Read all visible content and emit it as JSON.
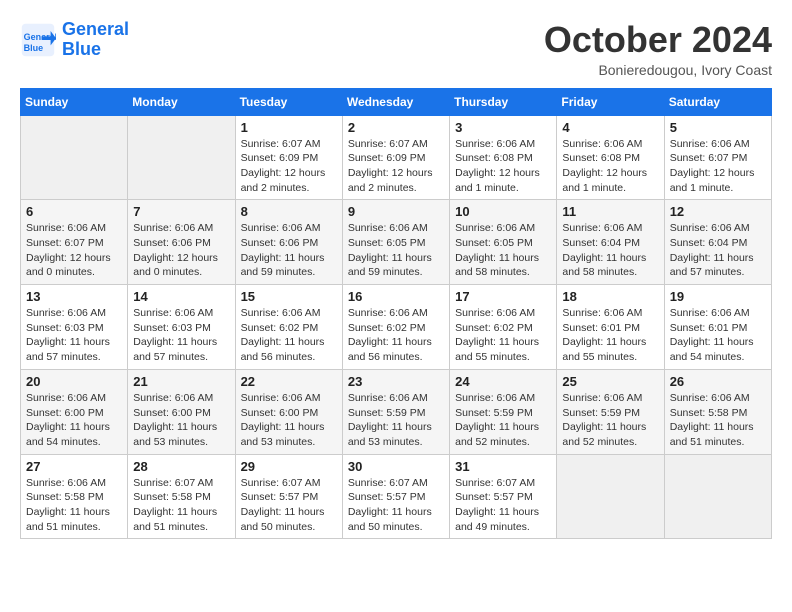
{
  "logo": {
    "line1": "General",
    "line2": "Blue"
  },
  "title": "October 2024",
  "subtitle": "Bonieredougou, Ivory Coast",
  "days_header": [
    "Sunday",
    "Monday",
    "Tuesday",
    "Wednesday",
    "Thursday",
    "Friday",
    "Saturday"
  ],
  "weeks": [
    [
      {
        "day": "",
        "detail": ""
      },
      {
        "day": "",
        "detail": ""
      },
      {
        "day": "1",
        "detail": "Sunrise: 6:07 AM\nSunset: 6:09 PM\nDaylight: 12 hours and 2 minutes."
      },
      {
        "day": "2",
        "detail": "Sunrise: 6:07 AM\nSunset: 6:09 PM\nDaylight: 12 hours and 2 minutes."
      },
      {
        "day": "3",
        "detail": "Sunrise: 6:06 AM\nSunset: 6:08 PM\nDaylight: 12 hours and 1 minute."
      },
      {
        "day": "4",
        "detail": "Sunrise: 6:06 AM\nSunset: 6:08 PM\nDaylight: 12 hours and 1 minute."
      },
      {
        "day": "5",
        "detail": "Sunrise: 6:06 AM\nSunset: 6:07 PM\nDaylight: 12 hours and 1 minute."
      }
    ],
    [
      {
        "day": "6",
        "detail": "Sunrise: 6:06 AM\nSunset: 6:07 PM\nDaylight: 12 hours and 0 minutes."
      },
      {
        "day": "7",
        "detail": "Sunrise: 6:06 AM\nSunset: 6:06 PM\nDaylight: 12 hours and 0 minutes."
      },
      {
        "day": "8",
        "detail": "Sunrise: 6:06 AM\nSunset: 6:06 PM\nDaylight: 11 hours and 59 minutes."
      },
      {
        "day": "9",
        "detail": "Sunrise: 6:06 AM\nSunset: 6:05 PM\nDaylight: 11 hours and 59 minutes."
      },
      {
        "day": "10",
        "detail": "Sunrise: 6:06 AM\nSunset: 6:05 PM\nDaylight: 11 hours and 58 minutes."
      },
      {
        "day": "11",
        "detail": "Sunrise: 6:06 AM\nSunset: 6:04 PM\nDaylight: 11 hours and 58 minutes."
      },
      {
        "day": "12",
        "detail": "Sunrise: 6:06 AM\nSunset: 6:04 PM\nDaylight: 11 hours and 57 minutes."
      }
    ],
    [
      {
        "day": "13",
        "detail": "Sunrise: 6:06 AM\nSunset: 6:03 PM\nDaylight: 11 hours and 57 minutes."
      },
      {
        "day": "14",
        "detail": "Sunrise: 6:06 AM\nSunset: 6:03 PM\nDaylight: 11 hours and 57 minutes."
      },
      {
        "day": "15",
        "detail": "Sunrise: 6:06 AM\nSunset: 6:02 PM\nDaylight: 11 hours and 56 minutes."
      },
      {
        "day": "16",
        "detail": "Sunrise: 6:06 AM\nSunset: 6:02 PM\nDaylight: 11 hours and 56 minutes."
      },
      {
        "day": "17",
        "detail": "Sunrise: 6:06 AM\nSunset: 6:02 PM\nDaylight: 11 hours and 55 minutes."
      },
      {
        "day": "18",
        "detail": "Sunrise: 6:06 AM\nSunset: 6:01 PM\nDaylight: 11 hours and 55 minutes."
      },
      {
        "day": "19",
        "detail": "Sunrise: 6:06 AM\nSunset: 6:01 PM\nDaylight: 11 hours and 54 minutes."
      }
    ],
    [
      {
        "day": "20",
        "detail": "Sunrise: 6:06 AM\nSunset: 6:00 PM\nDaylight: 11 hours and 54 minutes."
      },
      {
        "day": "21",
        "detail": "Sunrise: 6:06 AM\nSunset: 6:00 PM\nDaylight: 11 hours and 53 minutes."
      },
      {
        "day": "22",
        "detail": "Sunrise: 6:06 AM\nSunset: 6:00 PM\nDaylight: 11 hours and 53 minutes."
      },
      {
        "day": "23",
        "detail": "Sunrise: 6:06 AM\nSunset: 5:59 PM\nDaylight: 11 hours and 53 minutes."
      },
      {
        "day": "24",
        "detail": "Sunrise: 6:06 AM\nSunset: 5:59 PM\nDaylight: 11 hours and 52 minutes."
      },
      {
        "day": "25",
        "detail": "Sunrise: 6:06 AM\nSunset: 5:59 PM\nDaylight: 11 hours and 52 minutes."
      },
      {
        "day": "26",
        "detail": "Sunrise: 6:06 AM\nSunset: 5:58 PM\nDaylight: 11 hours and 51 minutes."
      }
    ],
    [
      {
        "day": "27",
        "detail": "Sunrise: 6:06 AM\nSunset: 5:58 PM\nDaylight: 11 hours and 51 minutes."
      },
      {
        "day": "28",
        "detail": "Sunrise: 6:07 AM\nSunset: 5:58 PM\nDaylight: 11 hours and 51 minutes."
      },
      {
        "day": "29",
        "detail": "Sunrise: 6:07 AM\nSunset: 5:57 PM\nDaylight: 11 hours and 50 minutes."
      },
      {
        "day": "30",
        "detail": "Sunrise: 6:07 AM\nSunset: 5:57 PM\nDaylight: 11 hours and 50 minutes."
      },
      {
        "day": "31",
        "detail": "Sunrise: 6:07 AM\nSunset: 5:57 PM\nDaylight: 11 hours and 49 minutes."
      },
      {
        "day": "",
        "detail": ""
      },
      {
        "day": "",
        "detail": ""
      }
    ]
  ]
}
